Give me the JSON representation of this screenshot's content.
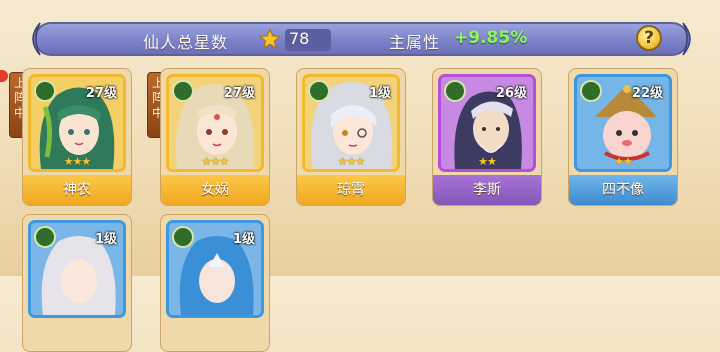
{
  "header": {
    "total_stars_label": "仙人总星数",
    "total_stars_value": "78",
    "main_attr_label": "主属性",
    "main_attr_bonus": "+9.85%",
    "help_label": "?"
  },
  "deploy_tag": "上阵中",
  "cards": [
    {
      "name": "神农",
      "level": "27级",
      "stars": "★★★",
      "rarity": "gold",
      "deployed": true
    },
    {
      "name": "女娲",
      "level": "27级",
      "stars": "★★★",
      "rarity": "gold",
      "deployed": true
    },
    {
      "name": "琼霄",
      "level": "1级",
      "stars": "★★★",
      "rarity": "gold",
      "deployed": false
    },
    {
      "name": "李斯",
      "level": "26级",
      "stars": "★★",
      "rarity": "purple",
      "deployed": false
    },
    {
      "name": "四不像",
      "level": "22级",
      "stars": "★★",
      "rarity": "blue",
      "deployed": false
    },
    {
      "name": "",
      "level": "1级",
      "stars": "",
      "rarity": "blue",
      "deployed": false
    },
    {
      "name": "",
      "level": "1级",
      "stars": "",
      "rarity": "blue",
      "deployed": false
    }
  ],
  "colors": {
    "gold": "#f0a71f",
    "purple": "#8357b7",
    "blue": "#3d8ccf",
    "bonus": "#8cf36c"
  }
}
